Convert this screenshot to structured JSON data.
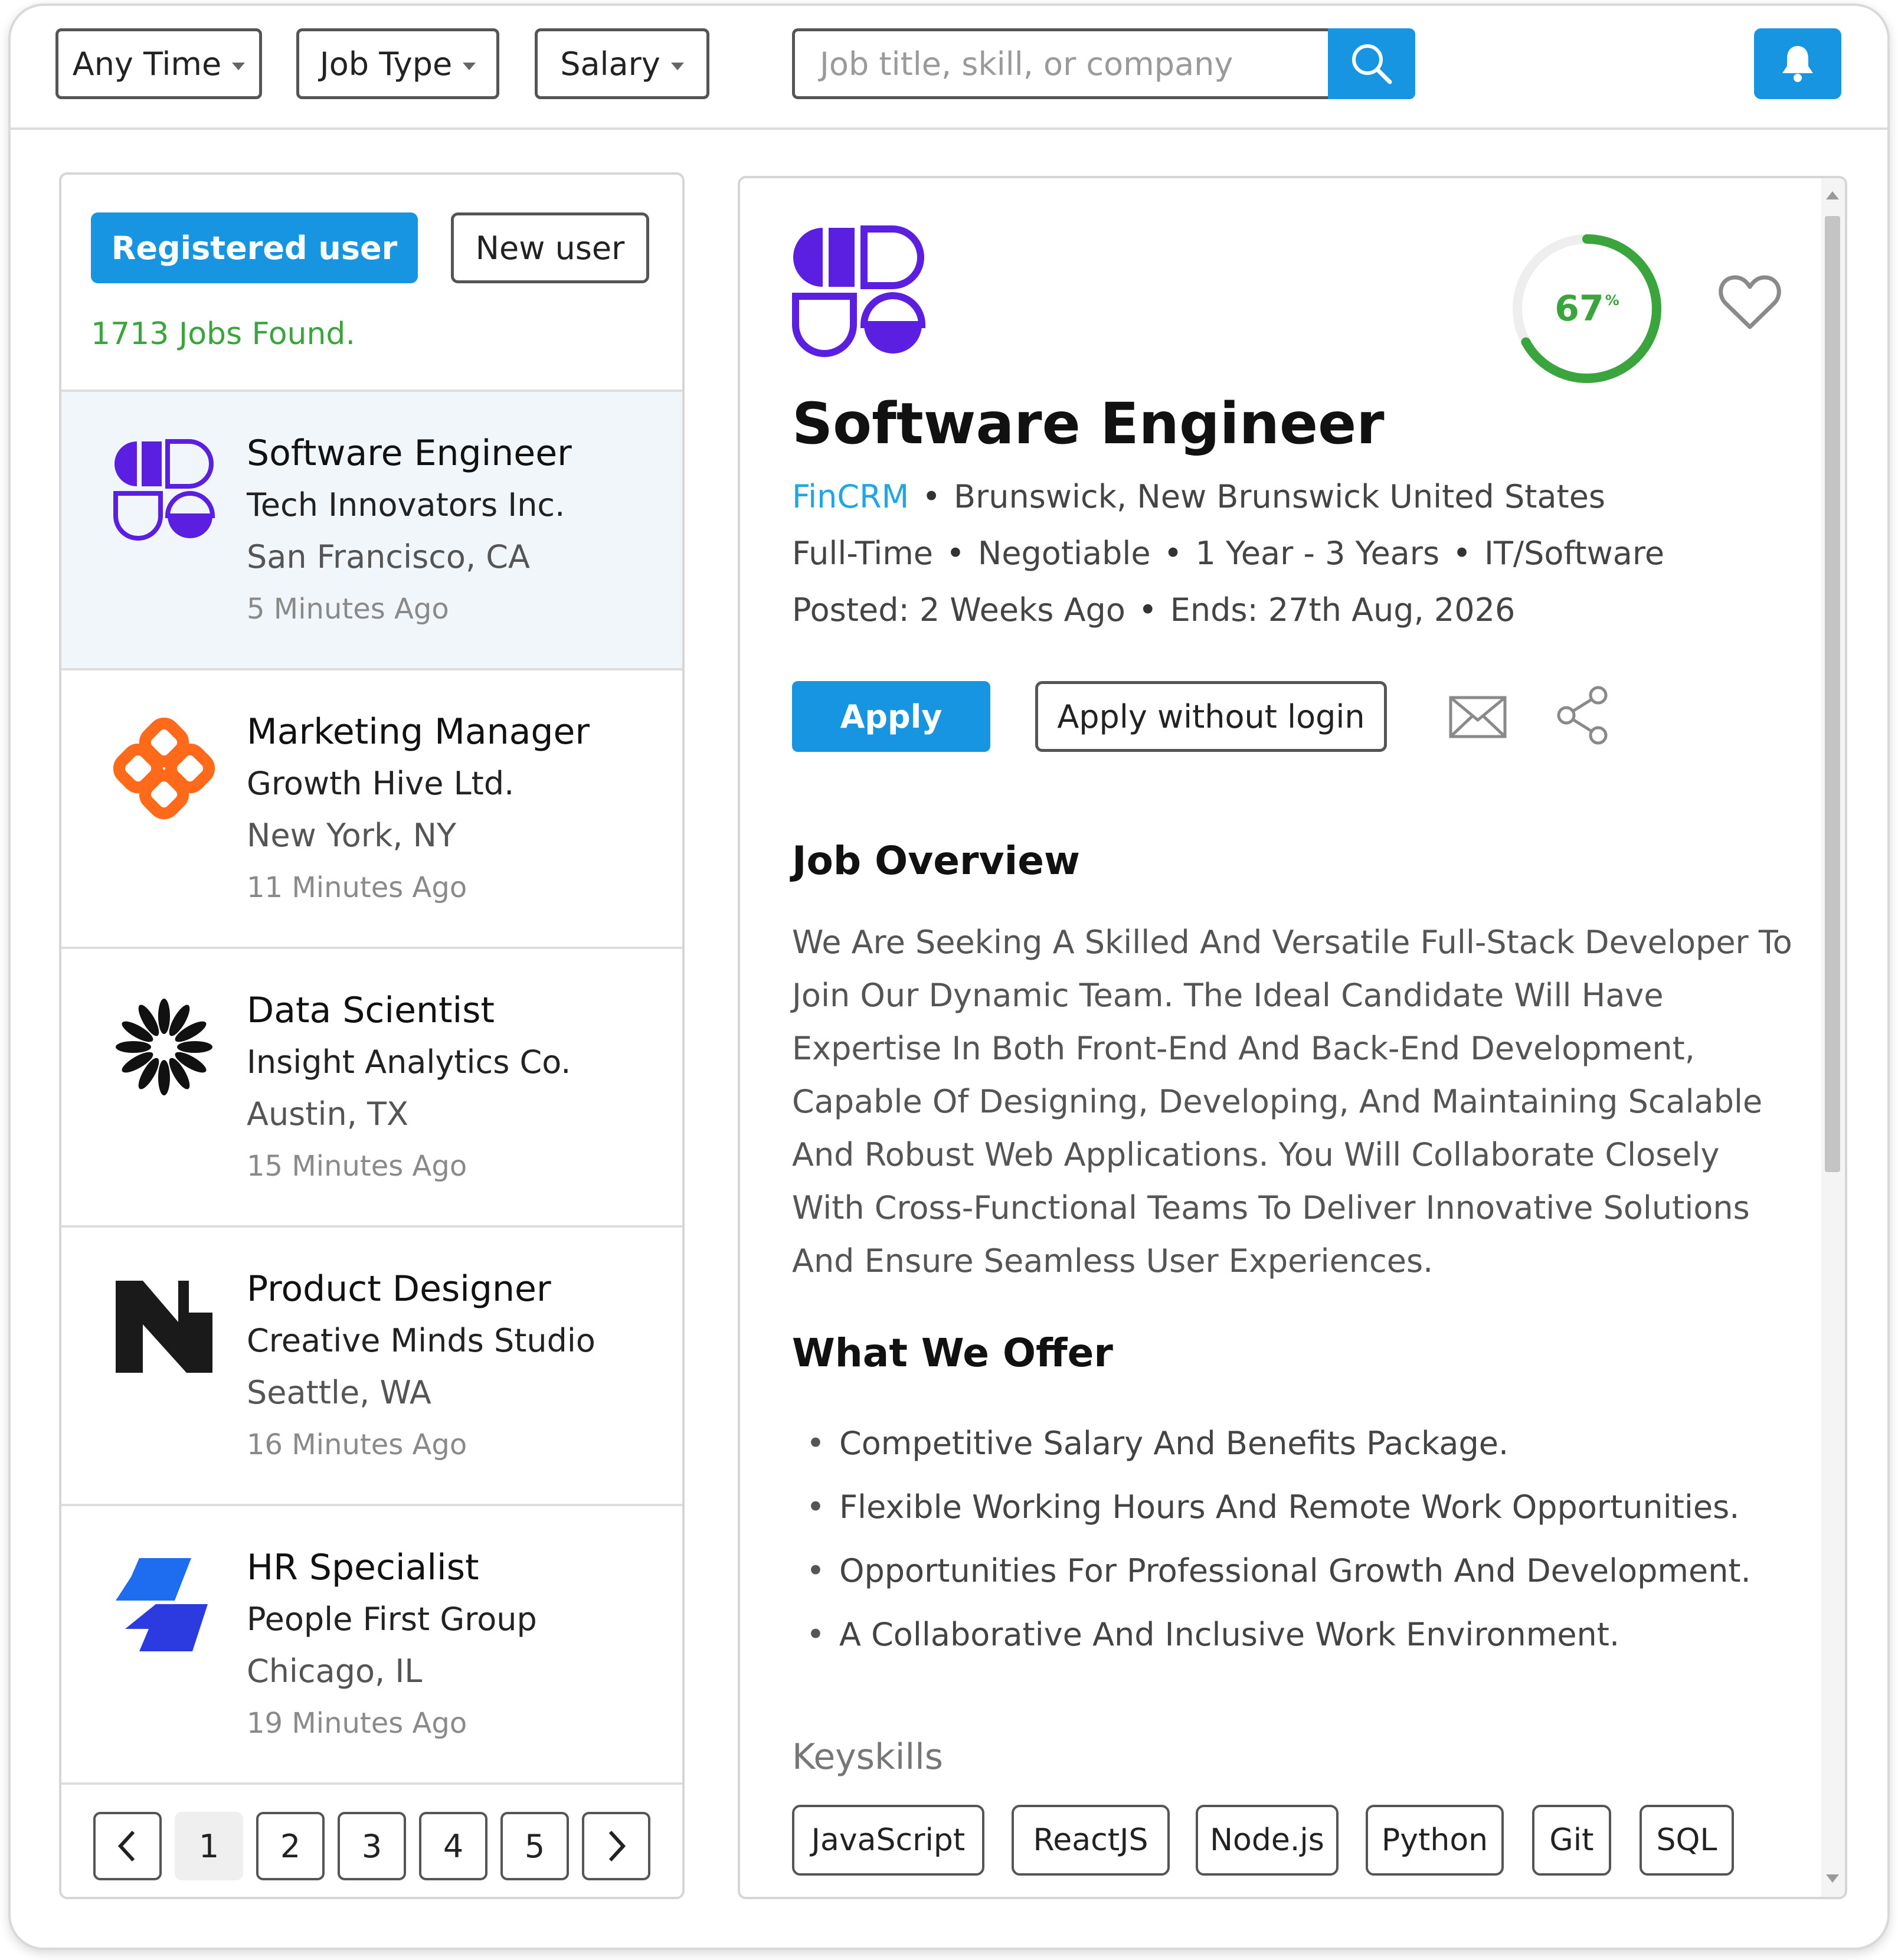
{
  "filters": {
    "any_time": "Any Time",
    "job_type": "Job Type",
    "salary": "Salary"
  },
  "search": {
    "placeholder": "Job title, skill, or company"
  },
  "sidebar": {
    "registered_label": "Registered user",
    "new_user_label": "New user",
    "jobs_found": "1713 Jobs Found.",
    "jobs": [
      {
        "title": "Software Engineer",
        "company": "Tech Innovators Inc.",
        "location": "San Francisco, CA",
        "time": "5 Minutes Ago",
        "logo": "purple-shapes-logo"
      },
      {
        "title": "Marketing Manager",
        "company": "Growth Hive Ltd.",
        "location": "New York, NY",
        "time": "11 Minutes Ago",
        "logo": "orange-flower-logo"
      },
      {
        "title": "Data Scientist",
        "company": "Insight Analytics Co.",
        "location": "Austin, TX",
        "time": "15 Minutes Ago",
        "logo": "black-burst-logo"
      },
      {
        "title": "Product Designer",
        "company": "Creative Minds Studio",
        "location": "Seattle, WA",
        "time": "16 Minutes Ago",
        "logo": "black-n-logo"
      },
      {
        "title": "HR Specialist",
        "company": "People First Group",
        "location": "Chicago, IL",
        "time": "19 Minutes Ago",
        "logo": "blue-parallelogram-logo"
      }
    ],
    "pages": [
      "1",
      "2",
      "3",
      "4",
      "5"
    ],
    "current_page": "1"
  },
  "detail": {
    "title": "Software Engineer",
    "company": "FinCRM",
    "location": "Brunswick, New Brunswick United States",
    "job_type": "Full-Time",
    "salary": "Negotiable",
    "experience": "1 Year - 3 Years",
    "category": "IT/Software",
    "posted": "Posted: 2 Weeks Ago",
    "ends": "Ends: 27th Aug, 2026",
    "match_value": "67",
    "match_unit": "%",
    "match_fraction": 0.67,
    "apply_label": "Apply",
    "apply_nologin_label": "Apply without login",
    "overview_title": "Job Overview",
    "overview_text": "We Are Seeking A Skilled And Versatile Full-Stack Developer To Join Our Dynamic Team. The Ideal Candidate Will Have Expertise In Both Front-End And Back-End Development, Capable Of Designing, Developing, And Maintaining Scalable And Robust Web Applications. You Will Collaborate Closely With Cross-Functional Teams To Deliver Innovative Solutions And Ensure Seamless User Experiences.",
    "offer_title": "What We Offer",
    "offers": [
      "Competitive Salary And Benefits Package.",
      "Flexible Working Hours And Remote Work Opportunities.",
      "Opportunities For Professional Growth And Development.",
      "A Collaborative And Inclusive Work Environment."
    ],
    "skills_title": "Keyskills",
    "skills": [
      "JavaScript",
      "ReactJS",
      "Node.js",
      "Python",
      "Git",
      "SQL"
    ]
  },
  "colors": {
    "accent": "#1795e0",
    "match_green": "#3aa53d",
    "link": "#1ea6e6",
    "brand_purple": "#5a1fe0",
    "brand_orange": "#ff6a1a",
    "brand_blue": "#1e6cf0"
  },
  "icons": {
    "search": "search-icon",
    "bell": "bell-icon",
    "heart": "heart-icon",
    "mail": "mail-icon",
    "share": "share-icon",
    "prev": "chevron-left-icon",
    "next": "chevron-right-icon"
  }
}
